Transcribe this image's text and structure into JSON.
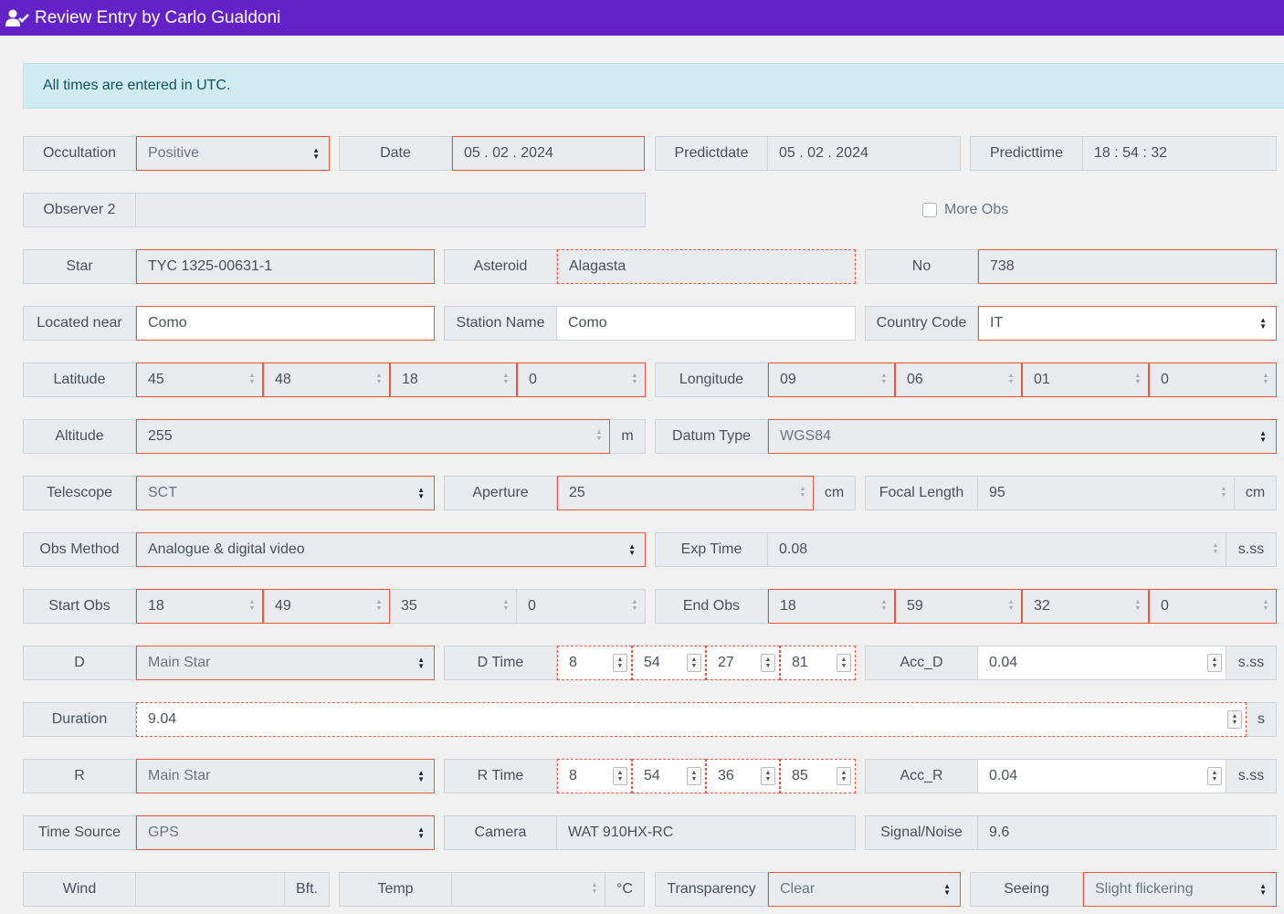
{
  "header": {
    "title": "Review Entry by Carlo Gualdoni"
  },
  "alert": {
    "text": "All times are entered in UTC."
  },
  "row1": {
    "occultation": {
      "label": "Occultation",
      "value": "Positive"
    },
    "date": {
      "label": "Date",
      "value": "05 . 02 . 2024"
    },
    "predictdate": {
      "label": "Predictdate",
      "value": "05 . 02 . 2024"
    },
    "predicttime": {
      "label": "Predicttime",
      "value": "18 : 54 : 32"
    }
  },
  "row2": {
    "observer2": {
      "label": "Observer 2",
      "value": ""
    },
    "more_obs": {
      "label": "More Obs",
      "checked": false
    }
  },
  "row3": {
    "star": {
      "label": "Star",
      "value": "TYC 1325-00631-1"
    },
    "asteroid": {
      "label": "Asteroid",
      "value": "Alagasta"
    },
    "no": {
      "label": "No",
      "value": "738"
    }
  },
  "row4": {
    "located_near": {
      "label": "Located near",
      "value": "Como"
    },
    "station_name": {
      "label": "Station Name",
      "value": "Como"
    },
    "country_code": {
      "label": "Country Code",
      "value": "IT"
    }
  },
  "row5": {
    "latitude": {
      "label": "Latitude",
      "values": [
        "45",
        "48",
        "18",
        "0"
      ]
    },
    "longitude": {
      "label": "Longitude",
      "values": [
        "09",
        "06",
        "01",
        "0"
      ]
    }
  },
  "row6": {
    "altitude": {
      "label": "Altitude",
      "value": "255",
      "unit": "m"
    },
    "datum_type": {
      "label": "Datum Type",
      "value": "WGS84"
    }
  },
  "row7": {
    "telescope": {
      "label": "Telescope",
      "value": "SCT"
    },
    "aperture": {
      "label": "Aperture",
      "value": "25",
      "unit": "cm"
    },
    "focal_length": {
      "label": "Focal Length",
      "value": "95",
      "unit": "cm"
    }
  },
  "row8": {
    "obs_method": {
      "label": "Obs Method",
      "value": "Analogue & digital video"
    },
    "exp_time": {
      "label": "Exp Time",
      "value": "0.08",
      "unit": "s.ss"
    }
  },
  "row9": {
    "start_obs": {
      "label": "Start Obs",
      "values": [
        "18",
        "49",
        "35",
        "0"
      ]
    },
    "end_obs": {
      "label": "End Obs",
      "values": [
        "18",
        "59",
        "32",
        "0"
      ]
    }
  },
  "row10": {
    "d": {
      "label": "D",
      "value": "Main Star"
    },
    "d_time": {
      "label": "D Time",
      "values": [
        "8",
        "54",
        "27",
        "81"
      ]
    },
    "acc_d": {
      "label": "Acc_D",
      "value": "0.04",
      "unit": "s.ss"
    }
  },
  "row11": {
    "duration": {
      "label": "Duration",
      "value": "9.04",
      "unit": "s"
    }
  },
  "row12": {
    "r": {
      "label": "R",
      "value": "Main Star"
    },
    "r_time": {
      "label": "R Time",
      "values": [
        "8",
        "54",
        "36",
        "85"
      ]
    },
    "acc_r": {
      "label": "Acc_R",
      "value": "0.04",
      "unit": "s.ss"
    }
  },
  "row13": {
    "time_source": {
      "label": "Time Source",
      "value": "GPS"
    },
    "camera": {
      "label": "Camera",
      "value": "WAT 910HX-RC"
    },
    "signal_noise": {
      "label": "Signal/Noise",
      "value": "9.6"
    }
  },
  "row14": {
    "wind": {
      "label": "Wind",
      "value": "",
      "unit": "Bft."
    },
    "temp": {
      "label": "Temp",
      "value": "",
      "unit": "°C"
    },
    "transparency": {
      "label": "Transparency",
      "value": "Clear"
    },
    "seeing": {
      "label": "Seeing",
      "value": "Slight flickering"
    }
  }
}
